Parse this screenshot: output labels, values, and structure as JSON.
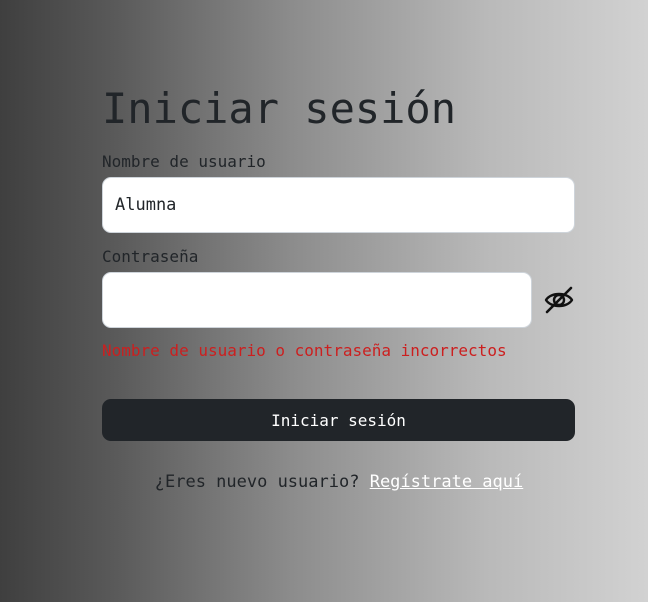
{
  "login": {
    "title": "Iniciar sesión",
    "username_label": "Nombre de usuario",
    "username_value": "Alumna",
    "password_label": "Contraseña",
    "password_value": "",
    "password_toggle_icon": "eye-slash-icon",
    "error_message": "Nombre de usuario o contraseña incorrectos",
    "submit_label": "Iniciar sesión",
    "register_prompt": "¿Eres nuevo usuario?",
    "register_link": "Regístrate aquí"
  },
  "colors": {
    "primary_dark": "#212529",
    "error": "#cc1f1f",
    "link": "#ffffff",
    "input_background": "#ffffff"
  }
}
